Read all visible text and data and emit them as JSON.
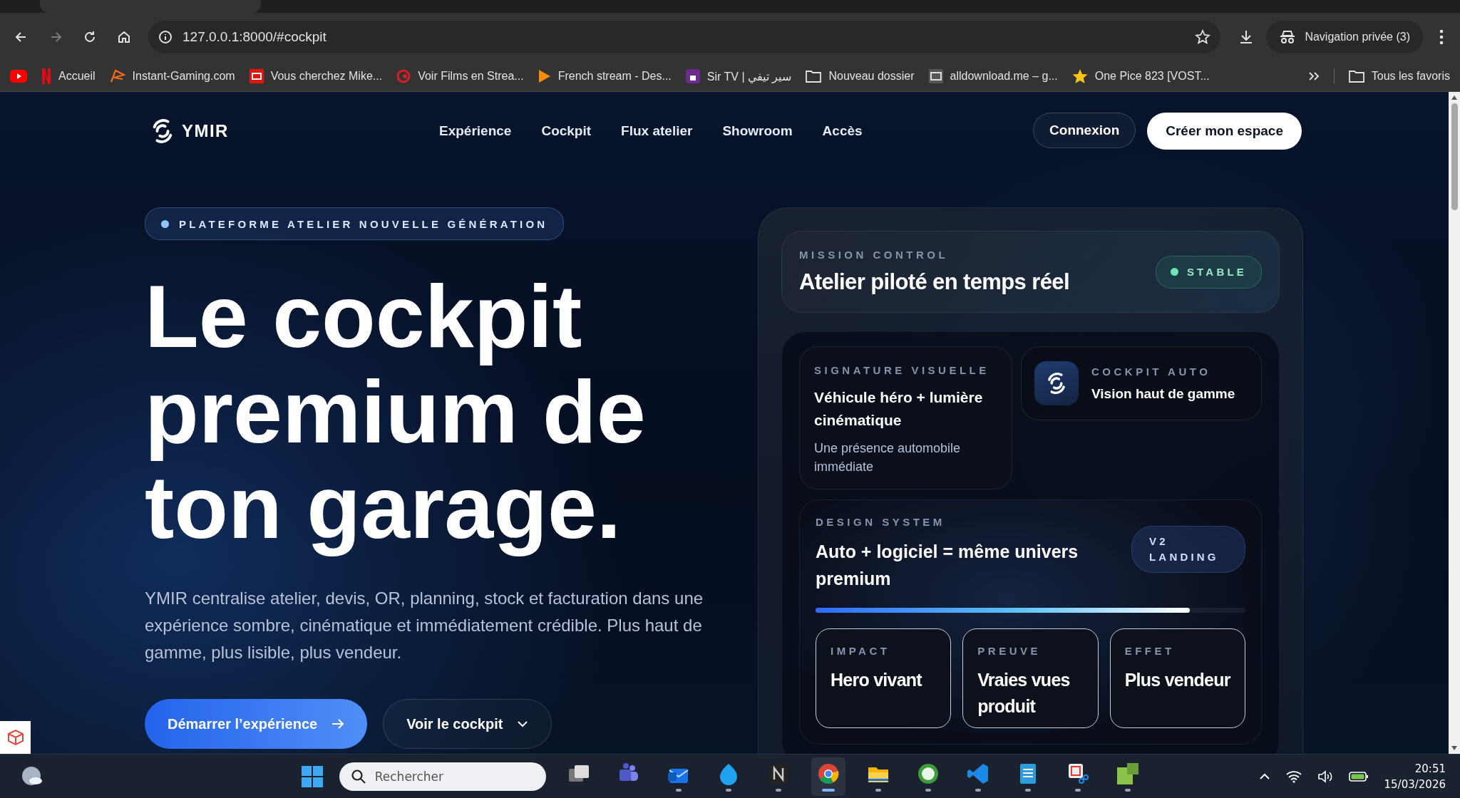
{
  "browser": {
    "nav_buttons": [
      {
        "kind": "back",
        "disabled": false
      },
      {
        "kind": "forward",
        "disabled": true
      },
      {
        "kind": "reload",
        "disabled": false
      },
      {
        "kind": "home",
        "disabled": false
      }
    ],
    "address_bar": {
      "url": "127.0.0.1:8000/#cockpit"
    },
    "profile": {
      "label": "Navigation privée (3)"
    },
    "bookmarks": [
      {
        "kind": "youtube"
      },
      {
        "kind": "netflix",
        "label": "Accueil"
      },
      {
        "kind": "instant",
        "label": "Instant-Gaming.com"
      },
      {
        "kind": "tv",
        "label": "Vous cherchez Mike..."
      },
      {
        "kind": "swirl",
        "label": "Voir Films en Strea..."
      },
      {
        "kind": "play",
        "label": "French stream - Des..."
      },
      {
        "kind": "siir",
        "label": "Sir TV | سير تيفي"
      },
      {
        "kind": "folder",
        "label": "Nouveau dossier"
      },
      {
        "kind": "grey",
        "label": "alldownload.me – g..."
      },
      {
        "kind": "star",
        "label": "One Pice 823 [VOST..."
      }
    ],
    "all_bookmarks": "Tous les favoris"
  },
  "page": {
    "logo": "YMIR",
    "nav": [
      "Expérience",
      "Cockpit",
      "Flux atelier",
      "Showroom",
      "Accès"
    ],
    "login": "Connexion",
    "signup": "Créer mon espace",
    "badge": "PLATEFORME ATELIER NOUVELLE GÉNÉRATION",
    "headline": "Le cockpit premium de ton garage.",
    "intro": "YMIR centralise atelier, devis, OR, planning, stock et facturation dans une expérience sombre, cinématique et immédiatement crédible. Plus haut de gamme, plus lisible, plus vendeur.",
    "buttons": [
      {
        "kind": "primary",
        "label": "Démarrer l’expérience"
      },
      {
        "kind": "secondary",
        "label": "Voir le cockpit"
      }
    ]
  },
  "panel": {
    "mission": {
      "eyebrow": "MISSION CONTROL",
      "title": "Atelier piloté en temps réel",
      "status": "STABLE"
    },
    "signature": {
      "eyebrow": "SIGNATURE VISUELLE",
      "title": "Véhicule héro + lumière cinématique",
      "text": "Une présence automobile immédiate"
    },
    "cockpit": {
      "eyebrow": "COCKPIT AUTO",
      "title": "Vision haut de gamme"
    },
    "design": {
      "eyebrow": "DESIGN SYSTEM",
      "title": "Auto + logiciel = même univers premium",
      "tag": "V2 LANDING",
      "level": 0.87,
      "stats": [
        {
          "label": "IMPACT",
          "value": "Hero vivant"
        },
        {
          "label": "PREUVE",
          "value": "Vraies vues produit"
        },
        {
          "label": "EFFET",
          "value": "Plus vendeur"
        }
      ]
    }
  },
  "taskbar": {
    "search": {
      "placeholder": "Rechercher"
    },
    "apps": [
      {
        "kind": "taskview",
        "running": false,
        "selected": false
      },
      {
        "kind": "people",
        "running": false,
        "selected": false
      },
      {
        "kind": "mail",
        "running": true,
        "selected": false
      },
      {
        "kind": "droplet",
        "running": true,
        "selected": false
      },
      {
        "kind": "darktile",
        "running": true,
        "selected": false
      },
      {
        "kind": "browser",
        "running": true,
        "selected": true
      },
      {
        "kind": "folder",
        "running": true,
        "selected": false
      },
      {
        "kind": "greenball",
        "running": true,
        "selected": false
      },
      {
        "kind": "code",
        "running": true,
        "selected": false
      },
      {
        "kind": "notepad",
        "running": true,
        "selected": false
      },
      {
        "kind": "scissors",
        "running": true,
        "selected": false
      },
      {
        "kind": "lambda",
        "running": true,
        "selected": false
      }
    ],
    "time": "20:51",
    "date": "15/03/2026"
  }
}
